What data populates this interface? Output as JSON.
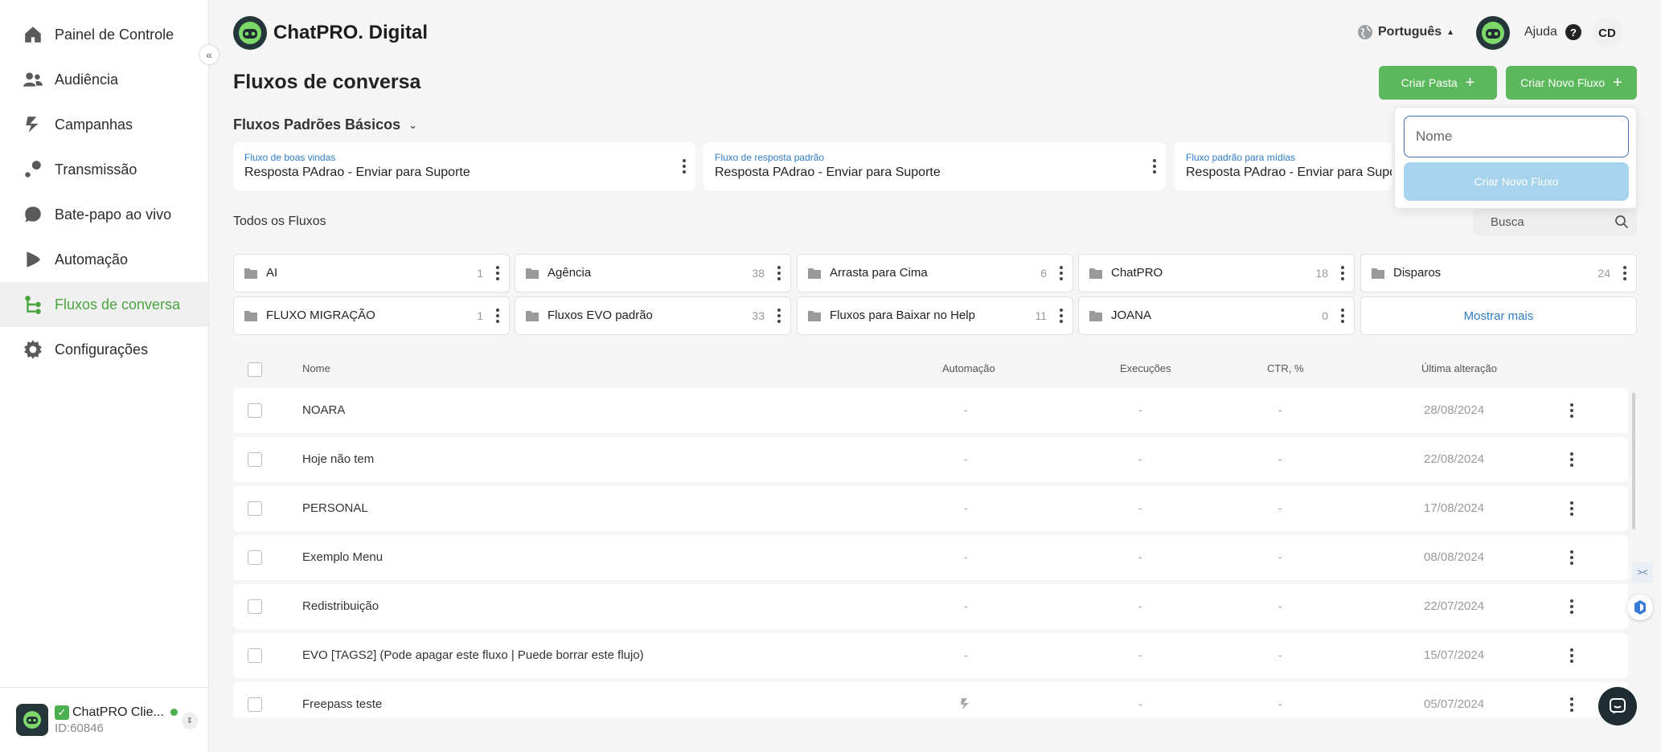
{
  "app": {
    "logo_text": "ChatPRO. Digital"
  },
  "sidebar": {
    "items": [
      {
        "label": "Painel de Controle",
        "icon": "home-icon"
      },
      {
        "label": "Audiência",
        "icon": "users-icon"
      },
      {
        "label": "Campanhas",
        "icon": "campaign-icon"
      },
      {
        "label": "Transmissão",
        "icon": "broadcast-icon"
      },
      {
        "label": "Bate-papo ao vivo",
        "icon": "chat-bubble-icon"
      },
      {
        "label": "Automação",
        "icon": "automation-icon"
      },
      {
        "label": "Fluxos de conversa",
        "icon": "flow-icon",
        "active": true
      },
      {
        "label": "Configurações",
        "icon": "gear-icon"
      }
    ],
    "account": {
      "name": "ChatPRO Clie...",
      "id": "ID:60846"
    }
  },
  "header": {
    "language": "Português",
    "help": "Ajuda",
    "help_symbol": "?",
    "user_initials": "CD"
  },
  "main": {
    "title": "Fluxos de conversa",
    "create_folder": "Criar Pasta",
    "create_flow": "Criar Novo Fluxo",
    "popover": {
      "placeholder": "Nome",
      "button": "Criar Novo Fluxo"
    },
    "defaults_title": "Fluxos Padrões Básicos",
    "defaults": [
      {
        "label": "Fluxo de boas vindas",
        "value": "Resposta PAdrao - Enviar para Suporte"
      },
      {
        "label": "Fluxo de resposta padrão",
        "value": "Resposta PAdrao - Enviar para Suporte"
      },
      {
        "label": "Fluxo padrão para mídias",
        "value": "Resposta PAdrao - Enviar para Suporte"
      }
    ],
    "all_title": "Todos os Fluxos",
    "search_placeholder": "Busca",
    "folders": [
      {
        "name": "AI",
        "count": "1"
      },
      {
        "name": "Agência",
        "count": "38"
      },
      {
        "name": "Arrasta para Cima",
        "count": "6"
      },
      {
        "name": "ChatPRO",
        "count": "18"
      },
      {
        "name": "Disparos",
        "count": "24"
      },
      {
        "name": "FLUXO MIGRAÇÃO",
        "count": "1"
      },
      {
        "name": "Fluxos EVO padrão",
        "count": "33"
      },
      {
        "name": "Fluxos para Baixar no Help",
        "count": "11"
      },
      {
        "name": "JOANA",
        "count": "0"
      }
    ],
    "show_more": "Mostrar mais",
    "table": {
      "headers": {
        "name": "Nome",
        "automation": "Automação",
        "executions": "Execuções",
        "ctr": "CTR, %",
        "last": "Última alteração"
      },
      "rows": [
        {
          "name": "NOARA",
          "automation": "-",
          "executions": "-",
          "ctr": "-",
          "date": "28/08/2024"
        },
        {
          "name": "Hoje não tem",
          "automation": "-",
          "executions": "-",
          "ctr": "-",
          "date": "22/08/2024"
        },
        {
          "name": "PERSONAL",
          "automation": "-",
          "executions": "-",
          "ctr": "-",
          "date": "17/08/2024"
        },
        {
          "name": "Exemplo Menu",
          "automation": "-",
          "executions": "-",
          "ctr": "-",
          "date": "08/08/2024"
        },
        {
          "name": "Redistribuição",
          "automation": "-",
          "executions": "-",
          "ctr": "-",
          "date": "22/07/2024"
        },
        {
          "name": "EVO [TAGS2] (Pode apagar este fluxo | Puede borrar este flujo)",
          "automation": "-",
          "executions": "-",
          "ctr": "-",
          "date": "15/07/2024"
        },
        {
          "name": "Freepass teste",
          "automation": "",
          "executions": "-",
          "ctr": "-",
          "date": "05/07/2024"
        }
      ]
    }
  },
  "colors": {
    "accent": "#5cb85c",
    "link": "#2e7bc4",
    "active_nav": "#4aa43f"
  }
}
